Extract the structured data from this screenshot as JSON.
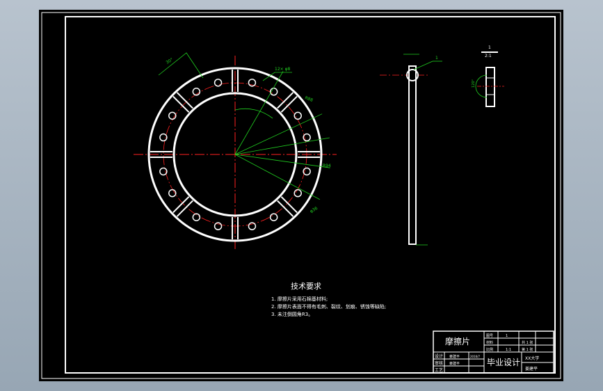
{
  "drawing": {
    "part_name": "摩擦片",
    "design_label": "毕业设计",
    "school": "XX大学",
    "author": "姜建平",
    "tech_requirements": {
      "title": "技术要求",
      "items": [
        "1. 摩擦片采用石棉基材料;",
        "2. 摩擦片表面不得有毛刺、裂纹、划痕、锈蚀等缺陷;",
        "3. 未注倒圆角R3。"
      ]
    },
    "title_block": {
      "row_labels": [
        "设计",
        "审核",
        "工艺"
      ],
      "row_names": [
        "姜建平",
        "姜建平"
      ],
      "date": "2016/7",
      "right_labels": [
        "图号",
        "材料",
        "比例"
      ],
      "right_values": [
        "1",
        "",
        "1:1"
      ],
      "right_extra": [
        "共 1 张",
        "第 1 张"
      ]
    },
    "dimensions": {
      "slot_count": "12× φ8",
      "r1": "R88",
      "r2": "R94",
      "angle": "30°",
      "dia": "φ36",
      "side_mark": "1",
      "section_mark": "1",
      "section_scale": "2:1",
      "section_angle": "120°"
    }
  },
  "colors": {
    "background": "#000000",
    "part_outline": "#ffffff",
    "centerline": "#ff2020",
    "dimension": "#20d020"
  }
}
